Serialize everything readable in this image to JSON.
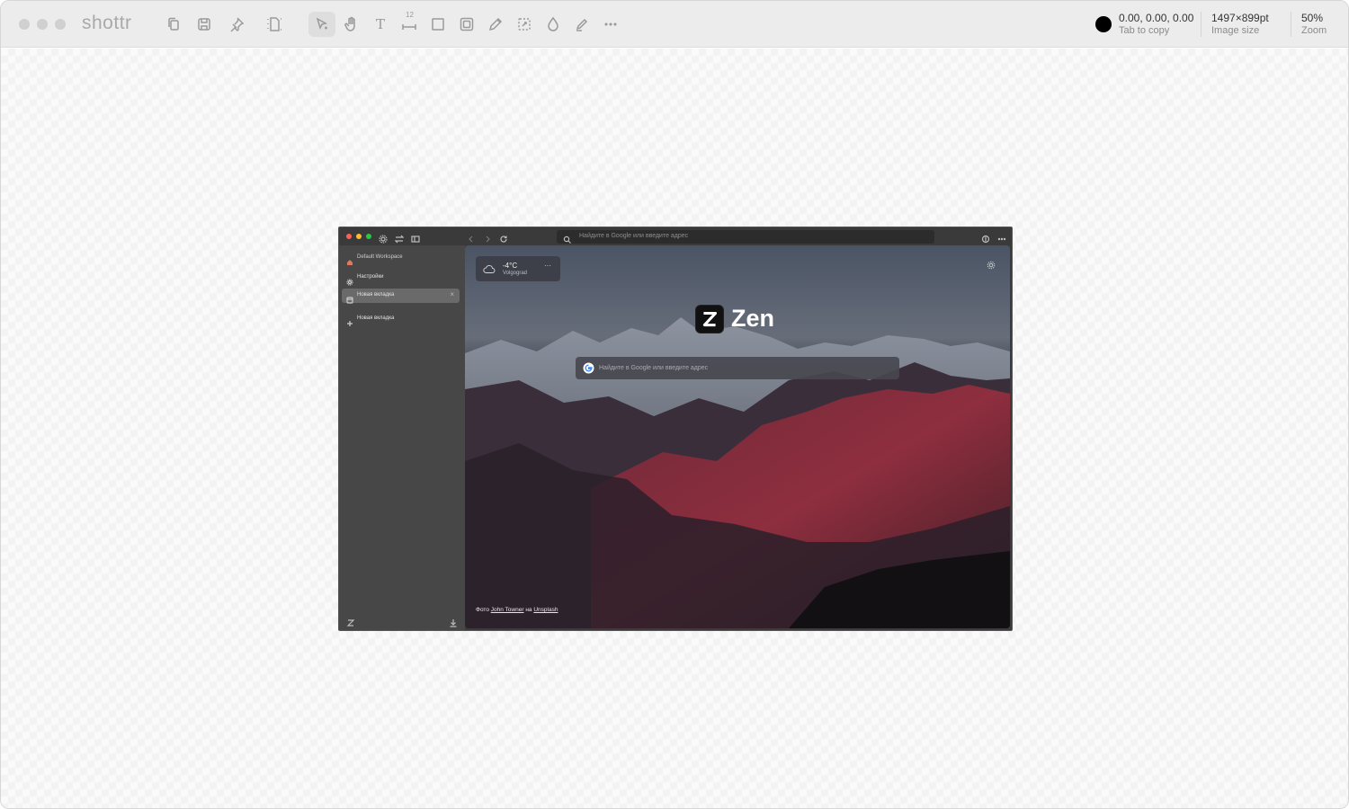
{
  "app": {
    "name": "shottr",
    "color_value": "0.00, 0.00, 0.00",
    "color_hint": "Tab to copy",
    "image_size": "1497×899pt",
    "image_size_label": "Image size",
    "zoom": "50%",
    "zoom_label": "Zoom",
    "swatch_color": "#000000"
  },
  "toolbar": {
    "tools": [
      "copy-icon",
      "save-icon",
      "pin-icon",
      "page-icon",
      "select-icon",
      "hand-icon",
      "text-icon",
      "ruler-icon",
      "rectangle-icon",
      "frame-icon",
      "pencil-icon",
      "crop-icon",
      "drop-icon",
      "marker-icon",
      "more-icon"
    ],
    "text_tool": "T",
    "ruler_tool": "12"
  },
  "screenshot": {
    "url_placeholder": "Найдите в Google или введите адрес",
    "sidebar": {
      "workspace": "Default Workspace",
      "settings": "Настройки",
      "current_tab": "Новая вкладка",
      "new_tab": "Новая вкладка"
    },
    "weather": {
      "temp": "-4°C",
      "city": "Volgograd",
      "more": "···"
    },
    "brand": "Zen",
    "search_placeholder": "Найдите в Google или введите адрес",
    "credit": {
      "prefix": "Фото",
      "author": "John Towner",
      "on": "на",
      "source": "Unsplash"
    }
  }
}
